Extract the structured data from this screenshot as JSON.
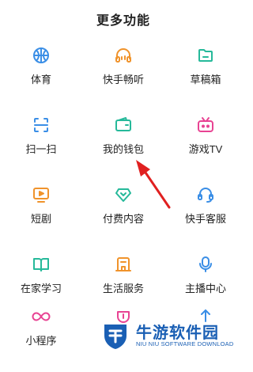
{
  "header": {
    "title": "更多功能"
  },
  "features": [
    {
      "label": "体育",
      "icon": "basketball-icon",
      "color": "#3a8ee6"
    },
    {
      "label": "快手畅听",
      "icon": "headphones-icon",
      "color": "#f0932b"
    },
    {
      "label": "草稿箱",
      "icon": "folder-icon",
      "color": "#26b99a"
    },
    {
      "label": "扫一扫",
      "icon": "scan-icon",
      "color": "#3a8ee6"
    },
    {
      "label": "我的钱包",
      "icon": "wallet-icon",
      "color": "#26b99a"
    },
    {
      "label": "游戏TV",
      "icon": "game-tv-icon",
      "color": "#e84393"
    },
    {
      "label": "短剧",
      "icon": "short-drama-icon",
      "color": "#f0932b"
    },
    {
      "label": "付费内容",
      "icon": "diamond-icon",
      "color": "#26b99a"
    },
    {
      "label": "快手客服",
      "icon": "headset-icon",
      "color": "#3a8ee6"
    },
    {
      "label": "在家学习",
      "icon": "book-icon",
      "color": "#26b99a"
    },
    {
      "label": "生活服务",
      "icon": "shop-icon",
      "color": "#f0932b"
    },
    {
      "label": "主播中心",
      "icon": "microphone-icon",
      "color": "#3a8ee6"
    },
    {
      "label": "小程序",
      "icon": "infinity-icon",
      "color": "#e84393"
    },
    {
      "label": "",
      "icon": "bottom-partial-icon",
      "color": "#e84393"
    },
    {
      "label": "",
      "icon": "bottom-partial-icon",
      "color": "#3a8ee6"
    }
  ],
  "annotation": {
    "arrow_color": "#e02020"
  },
  "watermark": {
    "title": "牛游软件园",
    "subtitle": "NIU NIU SOFTWARE DOWNLOAD",
    "color": "#1a5fb4"
  }
}
